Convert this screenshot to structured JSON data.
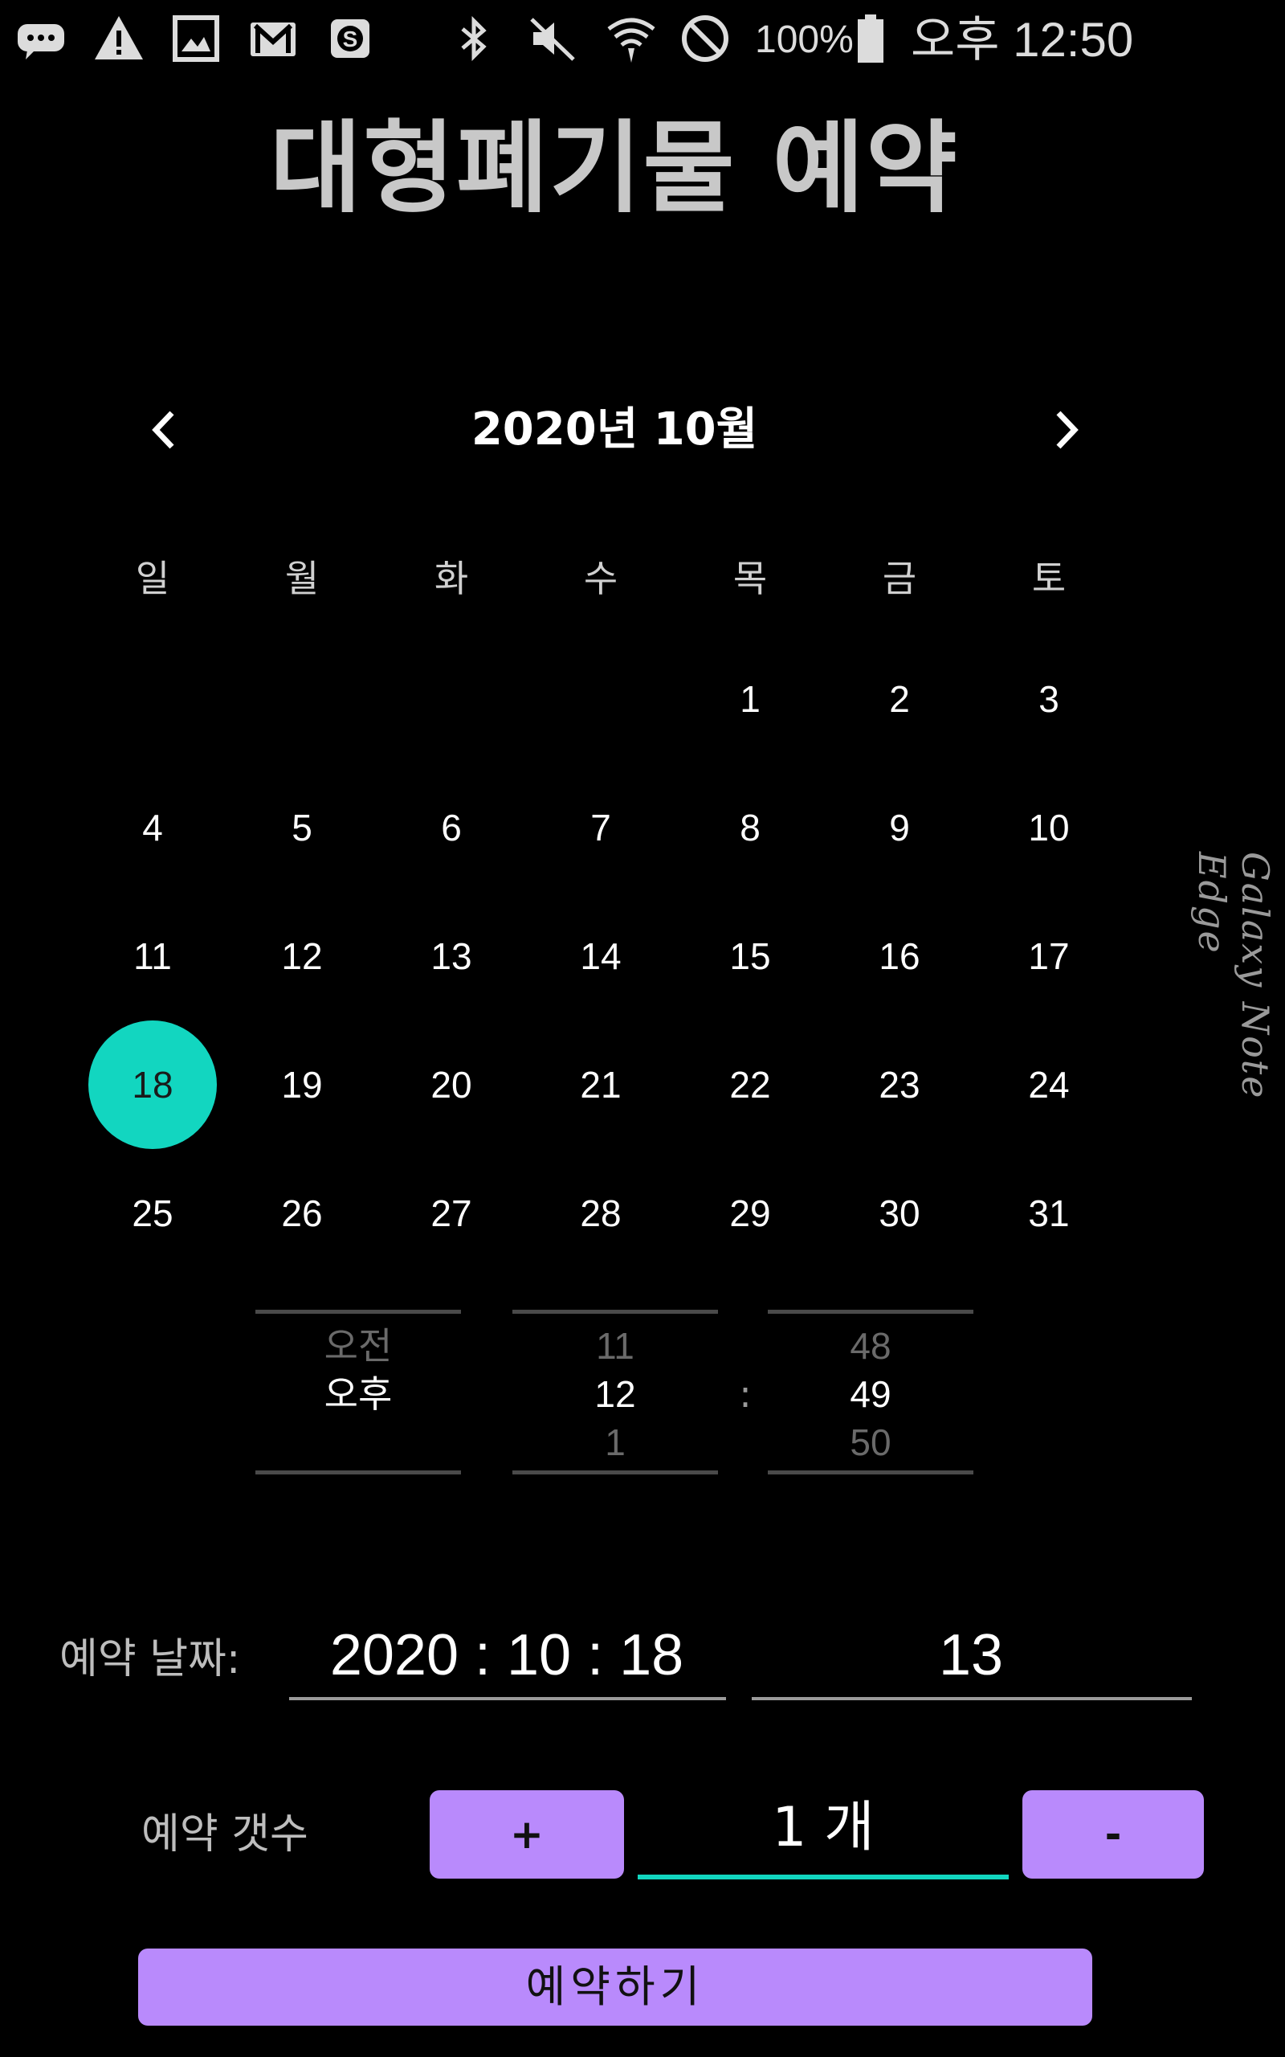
{
  "status_bar": {
    "battery": "100%",
    "time": "오후 12:50",
    "icons": [
      "chat-bubble-icon",
      "warning-icon",
      "image-icon",
      "gmail-icon",
      "money-app-icon",
      "bluetooth-icon",
      "mute-icon",
      "wifi-icon",
      "block-icon",
      "battery-icon"
    ]
  },
  "app": {
    "title": "대형폐기물 예약"
  },
  "calendar": {
    "month_title": "2020년 10월",
    "weekdays": [
      "일",
      "월",
      "화",
      "수",
      "목",
      "금",
      "토"
    ],
    "first_weekday_index": 4,
    "days": [
      "1",
      "2",
      "3",
      "4",
      "5",
      "6",
      "7",
      "8",
      "9",
      "10",
      "11",
      "12",
      "13",
      "14",
      "15",
      "16",
      "17",
      "18",
      "19",
      "20",
      "21",
      "22",
      "23",
      "24",
      "25",
      "26",
      "27",
      "28",
      "29",
      "30",
      "31"
    ],
    "selected_day": "18",
    "accent_color": "#12d6c0"
  },
  "time_picker": {
    "ampm": {
      "prev": "오전",
      "current": "오후",
      "next": ""
    },
    "hour": {
      "prev": "11",
      "current": "12",
      "next": "1"
    },
    "colon": ":",
    "minute": {
      "prev": "48",
      "current": "49",
      "next": "50"
    }
  },
  "reservation": {
    "date_label": "예약 날짜:",
    "date_value": "2020 : 10 : 18",
    "time_value": "13",
    "count_label": "예약 갯수",
    "plus_label": "+",
    "count_value": "1 개",
    "minus_label": "-",
    "submit_label": "예약하기",
    "button_color": "#b98afc"
  },
  "device": {
    "edge_label": "Galaxy Note Edge"
  }
}
